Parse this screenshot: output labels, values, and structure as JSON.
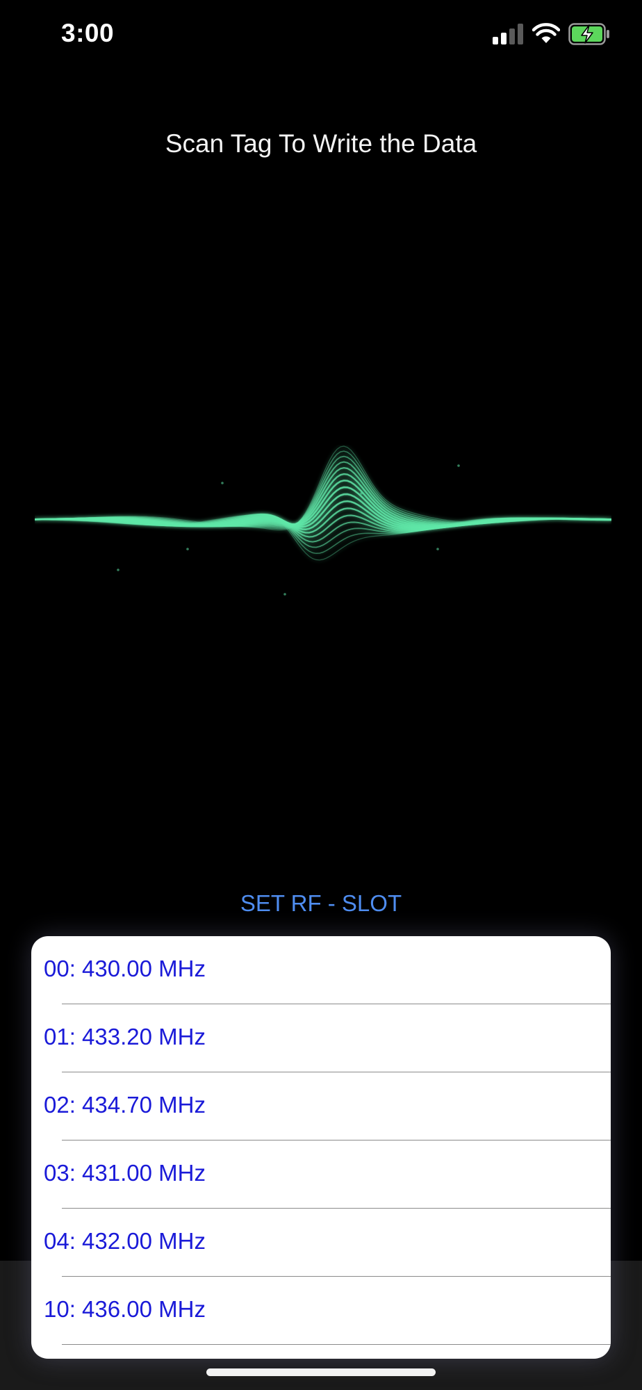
{
  "status_bar": {
    "time": "3:00",
    "icons": [
      "cellular-signal-icon",
      "wifi-icon",
      "battery-charging-icon"
    ]
  },
  "header": {
    "title": "Scan Tag To Write the Data"
  },
  "illustration": {
    "name": "sound-wave-graphic",
    "accent_color": "#5fe8a8"
  },
  "rf_section": {
    "button_label": "SET RF - SLOT",
    "button_color": "#4f8df0",
    "item_color": "#1a1ad8",
    "slots": [
      {
        "label": "00: 430.00 MHz"
      },
      {
        "label": "01: 433.20 MHz"
      },
      {
        "label": "02: 434.70 MHz"
      },
      {
        "label": "03: 431.00 MHz"
      },
      {
        "label": "04: 432.00 MHz"
      },
      {
        "label": "10: 436.00 MHz"
      }
    ]
  }
}
